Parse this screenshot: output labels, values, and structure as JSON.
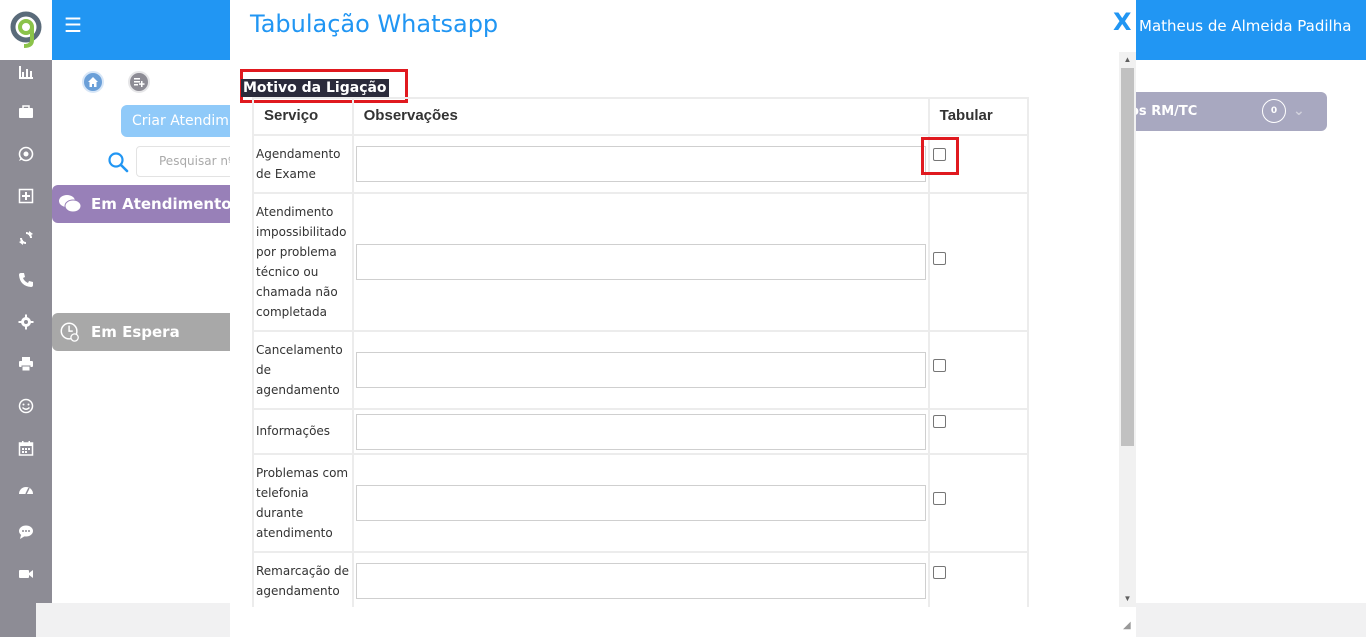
{
  "app": {
    "username": "Matheus de Almeida Padilha",
    "menu_icon": "hamburger-icon",
    "logo_icon": "app-logo"
  },
  "sidebar": {
    "icons": [
      "bar-chart-icon",
      "briefcase-icon",
      "whatsapp-icon",
      "plus-square-icon",
      "refresh-icon",
      "phone-icon",
      "gear-icon",
      "printer-icon",
      "smiley-icon",
      "calendar-icon",
      "dashboard-icon",
      "chat-bubble-icon",
      "video-camera-icon"
    ]
  },
  "background": {
    "criar_button": "Criar Atendim",
    "search_placeholder": "Pesquisar nº",
    "em_atendimento": "Em Atendimento",
    "em_espera": "Em Espera",
    "rm_tc_label": "os RM/TC",
    "rm_tc_count": "0"
  },
  "modal": {
    "title": "Tabulação Whatsapp",
    "close_label": "X",
    "section_label": "Motivo da Ligação",
    "headers": {
      "servico": "Serviço",
      "observacoes": "Observações",
      "tabular": "Tabular"
    },
    "rows": [
      {
        "servico": "Agendamento de Exame",
        "observacao": "",
        "tabular": false
      },
      {
        "servico": "Atendimento impossibilitado por problema técnico ou chamada não completada",
        "observacao": "",
        "tabular": false
      },
      {
        "servico": "Cancelamento de agendamento",
        "observacao": "",
        "tabular": false
      },
      {
        "servico": "Informações",
        "observacao": "",
        "tabular": false
      },
      {
        "servico": "Problemas com telefonia durante atendimento",
        "observacao": "",
        "tabular": false
      },
      {
        "servico": "Remarcação de agendamento",
        "observacao": "",
        "tabular": false
      }
    ]
  },
  "colors": {
    "primary": "#2196f3",
    "sidebar": "#8d8c95",
    "highlight": "#e0191f",
    "em_atendimento": "#9880b8",
    "em_espera": "#a8a8a8"
  }
}
